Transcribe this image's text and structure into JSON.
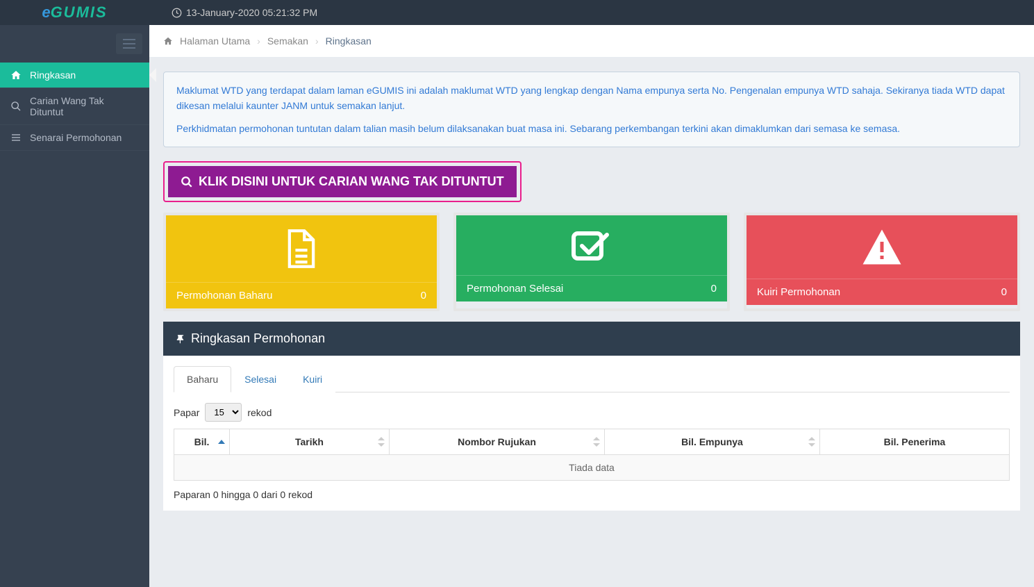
{
  "brand": {
    "e": "e",
    "gumis": "GUMIS"
  },
  "datetime": "13-January-2020 05:21:32 PM",
  "sidebar": {
    "items": [
      {
        "label": "Ringkasan"
      },
      {
        "label": "Carian Wang Tak Dituntut"
      },
      {
        "label": "Senarai Permohonan"
      }
    ]
  },
  "breadcrumb": {
    "home": "Halaman Utama",
    "mid": "Semakan",
    "current": "Ringkasan"
  },
  "info": {
    "p1": "Maklumat WTD yang terdapat dalam laman eGUMIS ini adalah maklumat WTD yang lengkap dengan Nama empunya serta No. Pengenalan empunya WTD sahaja. Sekiranya tiada WTD dapat dikesan melalui kaunter JANM untuk semakan lanjut.",
    "p2": "Perkhidmatan permohonan tuntutan dalam talian masih belum dilaksanakan buat masa ini. Sebarang perkembangan terkini akan dimaklumkan dari semasa ke semasa."
  },
  "big_button": "KLIK DISINI UNTUK CARIAN WANG TAK DITUNTUT",
  "stats": {
    "new": {
      "label": "Permohonan Baharu",
      "count": "0"
    },
    "done": {
      "label": "Permohonan Selesai",
      "count": "0"
    },
    "query": {
      "label": "Kuiri Permohonan",
      "count": "0"
    }
  },
  "panel": {
    "title": "Ringkasan Permohonan"
  },
  "tabs": {
    "t1": "Baharu",
    "t2": "Selesai",
    "t3": "Kuiri"
  },
  "table": {
    "show_prefix": "Papar",
    "show_suffix": "rekod",
    "per_page": "15",
    "cols": {
      "bil": "Bil.",
      "tarikh": "Tarikh",
      "rujukan": "Nombor Rujukan",
      "empunya": "Bil. Empunya",
      "penerima": "Bil. Penerima"
    },
    "no_data": "Tiada data",
    "info": "Paparan 0 hingga 0 dari 0 rekod"
  }
}
